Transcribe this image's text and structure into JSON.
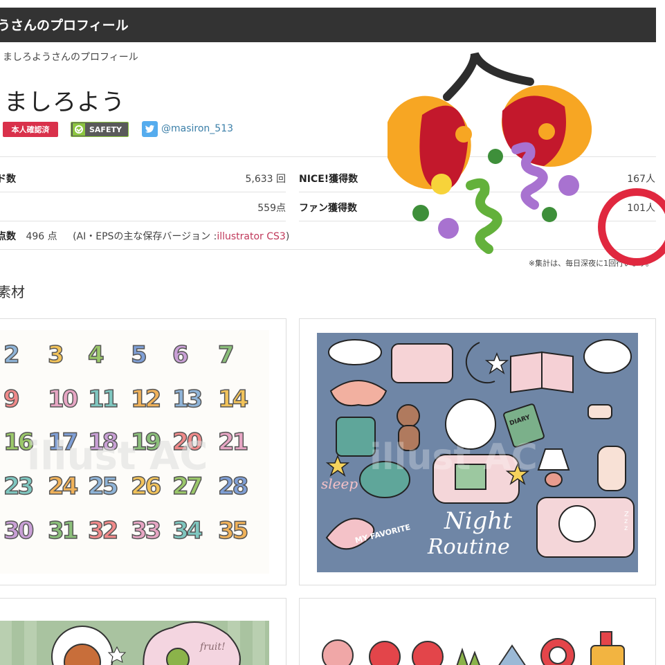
{
  "header": {
    "title": "うさんのプロフィール"
  },
  "breadcrumb": "ましろようさんのプロフィール",
  "profile": {
    "name": "ましろよう",
    "badge_verified": "本人確認済",
    "badge_safety": "SAFETY",
    "twitter_handle": "@masiron_513"
  },
  "stats": {
    "row1": {
      "label_left": "ド数",
      "value_left": "5,633 回",
      "label_right": "NICE!獲得数",
      "value_right": "167人"
    },
    "row2": {
      "value_left": "559点",
      "label_right": "ファン獲得数",
      "value_right": "101人"
    },
    "row3": {
      "label": "点数",
      "value": "496 点",
      "note_prefix": "(AI・EPSの主な保存バージョン :",
      "note_link": "illustrator CS3",
      "note_suffix": ")"
    }
  },
  "aggregate_note": "※集計は、毎日深夜に1回行います。",
  "section_title": "素材",
  "number_sheet": {
    "rows": [
      [
        "2",
        "3",
        "4",
        "5",
        "6",
        "7"
      ],
      [
        "9",
        "10",
        "11",
        "12",
        "13",
        "14"
      ],
      [
        "16",
        "17",
        "18",
        "19",
        "20",
        "21"
      ],
      [
        "23",
        "24",
        "25",
        "26",
        "27",
        "28"
      ],
      [
        "30",
        "31",
        "32",
        "33",
        "34",
        "35"
      ]
    ],
    "watermark": "illust AC"
  },
  "night_illustration": {
    "title_line1": "Night",
    "title_line2": "Routine",
    "word_sleep": "sleep",
    "word_favorite": "MY FAVORITE",
    "word_diary": "DIARY",
    "zzz": "Z z z",
    "watermark": "illust AC"
  },
  "fruit_card": {
    "label": "fruit!"
  },
  "colors": {
    "header_bg": "#333333",
    "verified_red": "#d9314b",
    "safety_green": "#8cc63f",
    "twitter_blue": "#55acee",
    "link_pink": "#c0395a",
    "night_bg": "#6f86a6",
    "circle_red": "#e0283f"
  },
  "icons": [
    "check-icon",
    "twitter-icon",
    "party-popper-icon"
  ]
}
